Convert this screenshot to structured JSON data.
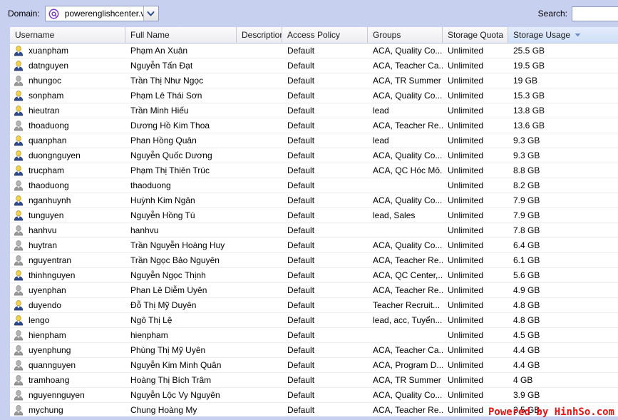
{
  "toolbar": {
    "domain_label": "Domain:",
    "domain_icon": "at-sign-icon",
    "domain_value": "powerenglishcenter.vn",
    "dropdown_icon": "chevron-down-icon",
    "search_label": "Search:",
    "search_value": "",
    "search_placeholder": ""
  },
  "table": {
    "columns": [
      {
        "key": "username",
        "label": "Username",
        "sorted": false
      },
      {
        "key": "fullname",
        "label": "Full Name",
        "sorted": false
      },
      {
        "key": "description",
        "label": "Description",
        "sorted": false
      },
      {
        "key": "access_policy",
        "label": "Access Policy",
        "sorted": false
      },
      {
        "key": "groups",
        "label": "Groups",
        "sorted": false
      },
      {
        "key": "storage_quota",
        "label": "Storage Quota",
        "sorted": false
      },
      {
        "key": "storage_usage",
        "label": "Storage Usage",
        "sorted": true,
        "sort_direction": "descending",
        "sort_icon": "triangle-down-icon"
      }
    ],
    "rows": [
      {
        "icon": "user-active-icon",
        "username": "xuanpham",
        "fullname": "Phạm An Xuân",
        "description": "",
        "access_policy": "Default",
        "groups": "ACA, Quality Co...",
        "storage_quota": "Unlimited",
        "storage_usage": "25.5 GB"
      },
      {
        "icon": "user-active-icon",
        "username": "datnguyen",
        "fullname": "Nguyễn Tấn Đạt",
        "description": "",
        "access_policy": "Default",
        "groups": "ACA, Teacher Ca...",
        "storage_quota": "Unlimited",
        "storage_usage": "19.5 GB"
      },
      {
        "icon": "user-inactive-icon",
        "username": "nhungoc",
        "fullname": "Trần Thị Như Ngọc",
        "description": "",
        "access_policy": "Default",
        "groups": "ACA, TR Summer",
        "storage_quota": "Unlimited",
        "storage_usage": "19 GB"
      },
      {
        "icon": "user-active-icon",
        "username": "sonpham",
        "fullname": "Phạm Lê Thái Sơn",
        "description": "",
        "access_policy": "Default",
        "groups": "ACA, Quality Co...",
        "storage_quota": "Unlimited",
        "storage_usage": "15.3 GB"
      },
      {
        "icon": "user-active-icon",
        "username": "hieutran",
        "fullname": "Trần Minh Hiếu",
        "description": "",
        "access_policy": "Default",
        "groups": "lead",
        "storage_quota": "Unlimited",
        "storage_usage": "13.8 GB"
      },
      {
        "icon": "user-inactive-icon",
        "username": "thoaduong",
        "fullname": "Dương Hồ Kim Thoa",
        "description": "",
        "access_policy": "Default",
        "groups": "ACA, Teacher Re...",
        "storage_quota": "Unlimited",
        "storage_usage": "13.6 GB"
      },
      {
        "icon": "user-active-icon",
        "username": "quanphan",
        "fullname": "Phan Hồng Quân",
        "description": "",
        "access_policy": "Default",
        "groups": "lead",
        "storage_quota": "Unlimited",
        "storage_usage": "9.3 GB"
      },
      {
        "icon": "user-active-icon",
        "username": "duongnguyen",
        "fullname": "Nguyễn Quốc Dương",
        "description": "",
        "access_policy": "Default",
        "groups": "ACA, Quality Co...",
        "storage_quota": "Unlimited",
        "storage_usage": "9.3 GB"
      },
      {
        "icon": "user-active-icon",
        "username": "trucpham",
        "fullname": "Phạm Thị Thiên Trúc",
        "description": "",
        "access_policy": "Default",
        "groups": "ACA, QC Hóc Mô...",
        "storage_quota": "Unlimited",
        "storage_usage": "8.8 GB"
      },
      {
        "icon": "user-inactive-icon",
        "username": "thaoduong",
        "fullname": "thaoduong",
        "description": "",
        "access_policy": "Default",
        "groups": "",
        "storage_quota": "Unlimited",
        "storage_usage": "8.2 GB"
      },
      {
        "icon": "user-active-icon",
        "username": "nganhuynh",
        "fullname": "Huỳnh Kim Ngân",
        "description": "",
        "access_policy": "Default",
        "groups": "ACA, Quality Co...",
        "storage_quota": "Unlimited",
        "storage_usage": "7.9 GB"
      },
      {
        "icon": "user-active-icon",
        "username": "tunguyen",
        "fullname": "Nguyễn Hồng Tú",
        "description": "",
        "access_policy": "Default",
        "groups": "lead, Sales",
        "storage_quota": "Unlimited",
        "storage_usage": "7.9 GB"
      },
      {
        "icon": "user-inactive-icon",
        "username": "hanhvu",
        "fullname": "hanhvu",
        "description": "",
        "access_policy": "Default",
        "groups": "",
        "storage_quota": "Unlimited",
        "storage_usage": "7.8 GB"
      },
      {
        "icon": "user-inactive-icon",
        "username": "huytran",
        "fullname": "Trần Nguyễn Hoàng Huy",
        "description": "",
        "access_policy": "Default",
        "groups": "ACA, Quality Co...",
        "storage_quota": "Unlimited",
        "storage_usage": "6.4 GB"
      },
      {
        "icon": "user-inactive-icon",
        "username": "nguyentran",
        "fullname": "Trần Ngọc Bảo Nguyên",
        "description": "",
        "access_policy": "Default",
        "groups": "ACA, Teacher Re...",
        "storage_quota": "Unlimited",
        "storage_usage": "6.1 GB"
      },
      {
        "icon": "user-active-icon",
        "username": "thinhnguyen",
        "fullname": "Nguyễn Ngọc Thịnh",
        "description": "",
        "access_policy": "Default",
        "groups": "ACA, QC Center,...",
        "storage_quota": "Unlimited",
        "storage_usage": "5.6 GB"
      },
      {
        "icon": "user-inactive-icon",
        "username": "uyenphan",
        "fullname": "Phan Lê Diễm Uyên",
        "description": "",
        "access_policy": "Default",
        "groups": "ACA, Teacher Re...",
        "storage_quota": "Unlimited",
        "storage_usage": "4.9 GB"
      },
      {
        "icon": "user-active-icon",
        "username": "duyendo",
        "fullname": "Đỗ Thị Mỹ Duyên",
        "description": "",
        "access_policy": "Default",
        "groups": "Teacher Recruit...",
        "storage_quota": "Unlimited",
        "storage_usage": "4.8 GB"
      },
      {
        "icon": "user-active-icon",
        "username": "lengo",
        "fullname": "Ngô Thị Lệ",
        "description": "",
        "access_policy": "Default",
        "groups": "lead, acc, Tuyển...",
        "storage_quota": "Unlimited",
        "storage_usage": "4.8 GB"
      },
      {
        "icon": "user-inactive-icon",
        "username": "hienpham",
        "fullname": "hienpham",
        "description": "",
        "access_policy": "Default",
        "groups": "",
        "storage_quota": "Unlimited",
        "storage_usage": "4.5 GB"
      },
      {
        "icon": "user-inactive-icon",
        "username": "uyenphung",
        "fullname": "Phùng Thị Mỹ Uyên",
        "description": "",
        "access_policy": "Default",
        "groups": "ACA, Teacher Ca...",
        "storage_quota": "Unlimited",
        "storage_usage": "4.4 GB"
      },
      {
        "icon": "user-inactive-icon",
        "username": "quannguyen",
        "fullname": "Nguyễn Kim Minh Quân",
        "description": "",
        "access_policy": "Default",
        "groups": "ACA, Program D...",
        "storage_quota": "Unlimited",
        "storage_usage": "4.4 GB"
      },
      {
        "icon": "user-inactive-icon",
        "username": "tramhoang",
        "fullname": "Hoàng Thị Bích Trâm",
        "description": "",
        "access_policy": "Default",
        "groups": "ACA, TR Summer",
        "storage_quota": "Unlimited",
        "storage_usage": "4 GB"
      },
      {
        "icon": "user-inactive-icon",
        "username": "nguyennguyen",
        "fullname": "Nguyễn Lộc Vy Nguyên",
        "description": "",
        "access_policy": "Default",
        "groups": "ACA, Quality Co...",
        "storage_quota": "Unlimited",
        "storage_usage": "3.9 GB"
      },
      {
        "icon": "user-inactive-icon",
        "username": "mychung",
        "fullname": "Chung Hoàng My",
        "description": "",
        "access_policy": "Default",
        "groups": "ACA, Teacher Re...",
        "storage_quota": "Unlimited",
        "storage_usage": "3.5 GB"
      }
    ]
  },
  "watermark": {
    "text": "Powered by HinhSo.com",
    "color": "#e81010"
  },
  "colors": {
    "toolbar_background": "#c8d0f0",
    "sorted_column_background": "#cfe0f7",
    "header_background": "#ededf1",
    "row_separator": "#ededed",
    "at_icon": "#7b38c9"
  }
}
